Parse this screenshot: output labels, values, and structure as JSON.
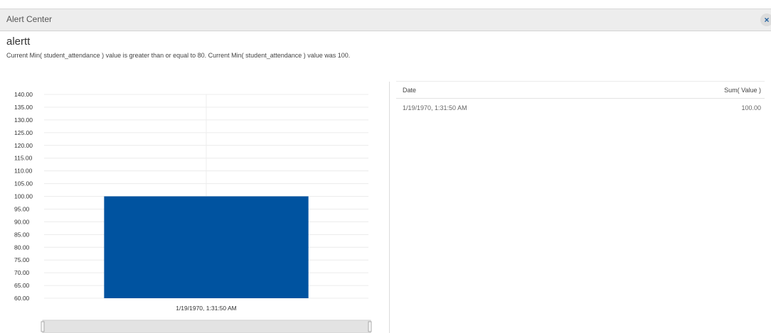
{
  "window": {
    "title": "Alert Center",
    "close_label": "×"
  },
  "alert": {
    "name": "alertt",
    "message": "Current Min( student_attendance ) value is greater than or equal to 80. Current Min( student_attendance ) value was 100."
  },
  "table": {
    "columns": [
      "Date",
      "Sum( Value )"
    ],
    "rows": [
      {
        "date": "1/19/1970, 1:31:50 AM",
        "sum": "100.00"
      }
    ]
  },
  "chart_data": {
    "type": "bar",
    "categories": [
      "1/19/1970, 1:31:50 AM"
    ],
    "values": [
      100
    ],
    "ylim": [
      60,
      140
    ],
    "yticks": [
      "140.00",
      "135.00",
      "130.00",
      "125.00",
      "120.00",
      "115.00",
      "110.00",
      "105.00",
      "100.00",
      "95.00",
      "90.00",
      "85.00",
      "80.00",
      "75.00",
      "70.00",
      "65.00",
      "60.00"
    ],
    "bar_color": "#0053a0",
    "grid": true
  }
}
